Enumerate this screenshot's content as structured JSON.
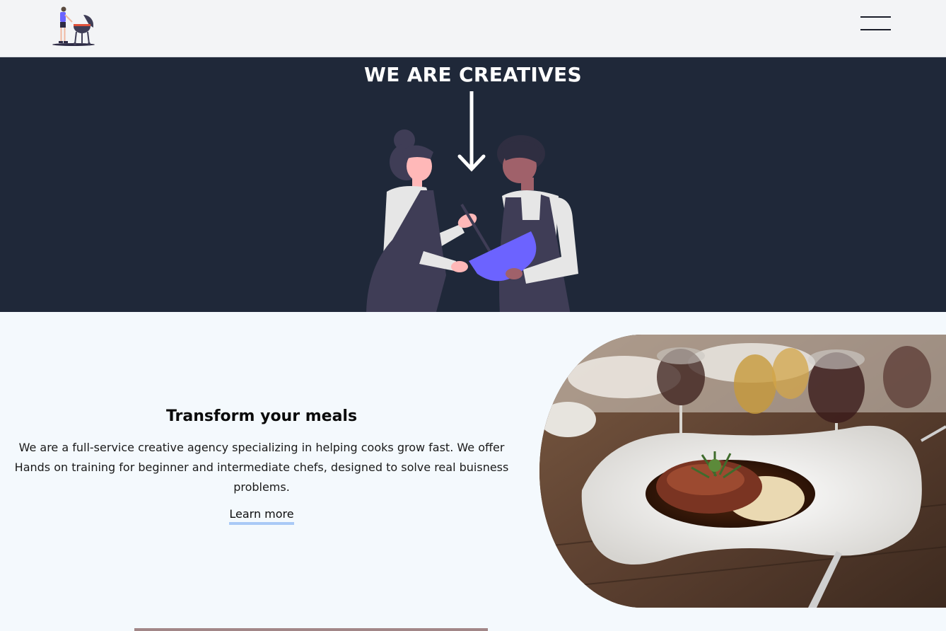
{
  "header": {
    "logo_icon": "person-grilling-icon",
    "menu_icon": "hamburger-menu-icon"
  },
  "hero": {
    "title": "WE ARE CREATIVES",
    "arrow_icon": "arrow-down-icon",
    "illustration": "two-chefs-cooking-illustration"
  },
  "feature": {
    "title": "Transform your meals",
    "description": "We are a full-service creative agency specializing in helping cooks grow fast. We offer Hands on training for beginner and intermediate chefs, designed to solve real buisness problems.",
    "link_label": "Learn more",
    "image": "plated-meat-dish-photo"
  },
  "colors": {
    "header_bg": "#f3f4f6",
    "hero_bg": "#1f2839",
    "page_bg": "#f4f9fd",
    "accent": "#6c63ff",
    "link_underline": "#a9c9f6"
  }
}
